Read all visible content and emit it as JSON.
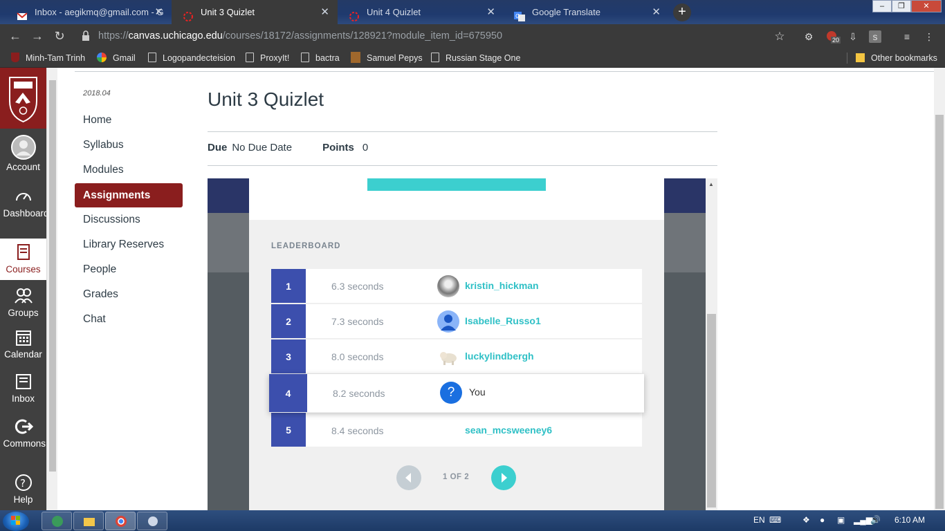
{
  "browser": {
    "tabs": [
      {
        "title": "Inbox - aegikmq@gmail.com - G",
        "icon": "gmail-icon",
        "active": false
      },
      {
        "title": "Unit 3 Quizlet",
        "icon": "canvas-icon",
        "active": true
      },
      {
        "title": "Unit 4 Quizlet",
        "icon": "canvas-icon",
        "active": false
      },
      {
        "title": "Google Translate",
        "icon": "translate-icon",
        "active": false
      }
    ],
    "new_tab_label": "+",
    "url": {
      "scheme": "https://",
      "host": "canvas.uchicago.edu",
      "path": "/courses/18172/assignments/128921?module_item_id=675950"
    },
    "extension_badge": "20",
    "bookmarks": [
      {
        "label": "Minh-Tam Trinh"
      },
      {
        "label": "Gmail"
      },
      {
        "label": "Logopandecteision"
      },
      {
        "label": "ProxyIt!"
      },
      {
        "label": "bactra"
      },
      {
        "label": "Samuel Pepys"
      },
      {
        "label": "Russian Stage One"
      }
    ],
    "other_bookmarks": "Other bookmarks"
  },
  "global_nav": {
    "items": [
      {
        "label": "Account",
        "icon": "account-icon"
      },
      {
        "label": "Dashboard",
        "icon": "dashboard-icon"
      },
      {
        "label": "Courses",
        "icon": "courses-icon"
      },
      {
        "label": "Groups",
        "icon": "groups-icon"
      },
      {
        "label": "Calendar",
        "icon": "calendar-icon"
      },
      {
        "label": "Inbox",
        "icon": "inbox-icon"
      },
      {
        "label": "Commons",
        "icon": "commons-icon"
      },
      {
        "label": "Help",
        "icon": "help-icon"
      }
    ]
  },
  "course_nav": {
    "term": "2018.04",
    "items": [
      "Home",
      "Syllabus",
      "Modules",
      "Assignments",
      "Discussions",
      "Library Reserves",
      "People",
      "Grades",
      "Chat"
    ],
    "active": "Assignments"
  },
  "assignment": {
    "title": "Unit 3 Quizlet",
    "due_label": "Due",
    "due_value": "No Due Date",
    "points_label": "Points",
    "points_value": "0"
  },
  "leaderboard": {
    "title": "LEADERBOARD",
    "rows": [
      {
        "rank": "1",
        "time": "6.3 seconds",
        "user": "kristin_hickman"
      },
      {
        "rank": "2",
        "time": "7.3 seconds",
        "user": "Isabelle_Russo1"
      },
      {
        "rank": "3",
        "time": "8.0 seconds",
        "user": "luckylindbergh"
      },
      {
        "rank": "4",
        "time": "8.2 seconds",
        "user": "You"
      },
      {
        "rank": "5",
        "time": "8.4 seconds",
        "user": "sean_mcsweeney6"
      }
    ],
    "pager": "1 OF 2"
  },
  "taskbar": {
    "language": "EN",
    "clock": "6:10 AM"
  },
  "colors": {
    "canvas_red": "#8a1e1e",
    "quizlet_teal": "#3ccfcf",
    "rank_blue": "#3c4fad"
  }
}
